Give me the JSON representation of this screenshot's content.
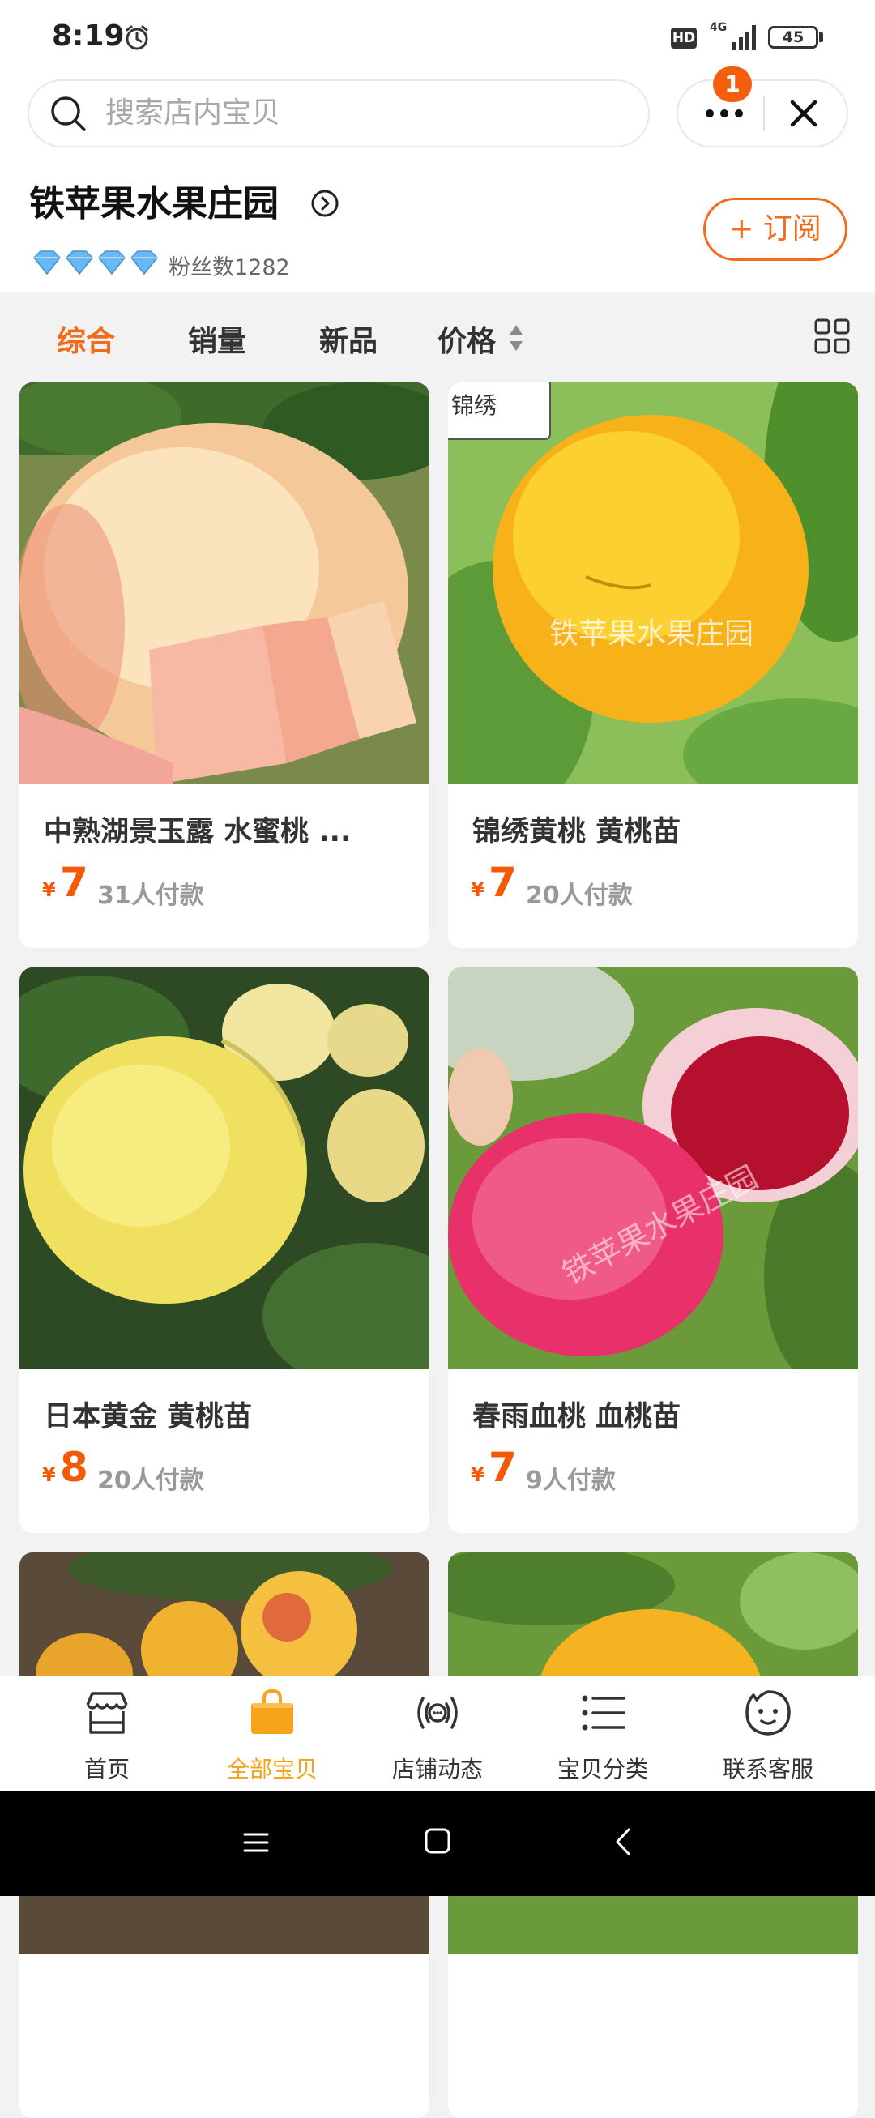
{
  "status_bar": {
    "time": "8:19",
    "hd_label": "HD",
    "network": "4G",
    "battery": "45"
  },
  "search": {
    "placeholder": "搜索店内宝贝",
    "notification_badge": "1"
  },
  "shop": {
    "name": "铁苹果水果庄园",
    "fans_label": "粉丝数1282",
    "diamond_count": 4,
    "subscribe_label": "+ 订阅"
  },
  "sort_tabs": [
    {
      "label": "综合",
      "active": true
    },
    {
      "label": "销量",
      "active": false
    },
    {
      "label": "新品",
      "active": false
    },
    {
      "label": "价格",
      "active": false
    }
  ],
  "products": [
    {
      "title": "中熟湖景玉露 水蜜桃 ...",
      "currency": "¥",
      "price": "7",
      "sold": "31人付款",
      "image": "white peach"
    },
    {
      "title": "锦绣黄桃  黄桃苗",
      "currency": "¥",
      "price": "7",
      "sold": "20人付款",
      "image": "yellow peach",
      "watermark": "铁苹果水果庄园",
      "corner_tag": "锦绣"
    },
    {
      "title": "日本黄金  黄桃苗",
      "currency": "¥",
      "price": "8",
      "sold": "20人付款",
      "image": "golden peach"
    },
    {
      "title": "春雨血桃 血桃苗",
      "currency": "¥",
      "price": "7",
      "sold": "9人付款",
      "image": "blood peach",
      "watermark": "铁苹果水果庄园"
    }
  ],
  "bottom_tabs": [
    {
      "label": "首页",
      "icon": "store-icon",
      "active": false
    },
    {
      "label": "全部宝贝",
      "icon": "shopping-bag-icon",
      "active": true
    },
    {
      "label": "店铺动态",
      "icon": "broadcast-icon",
      "active": false
    },
    {
      "label": "宝贝分类",
      "icon": "list-icon",
      "active": false
    },
    {
      "label": "联系客服",
      "icon": "customer-service-icon",
      "active": false
    }
  ],
  "colors": {
    "accent": "#f26a1b",
    "price": "#f25a0a",
    "active_tab": "#f7a21b",
    "diamond": "#6bb8f0"
  }
}
